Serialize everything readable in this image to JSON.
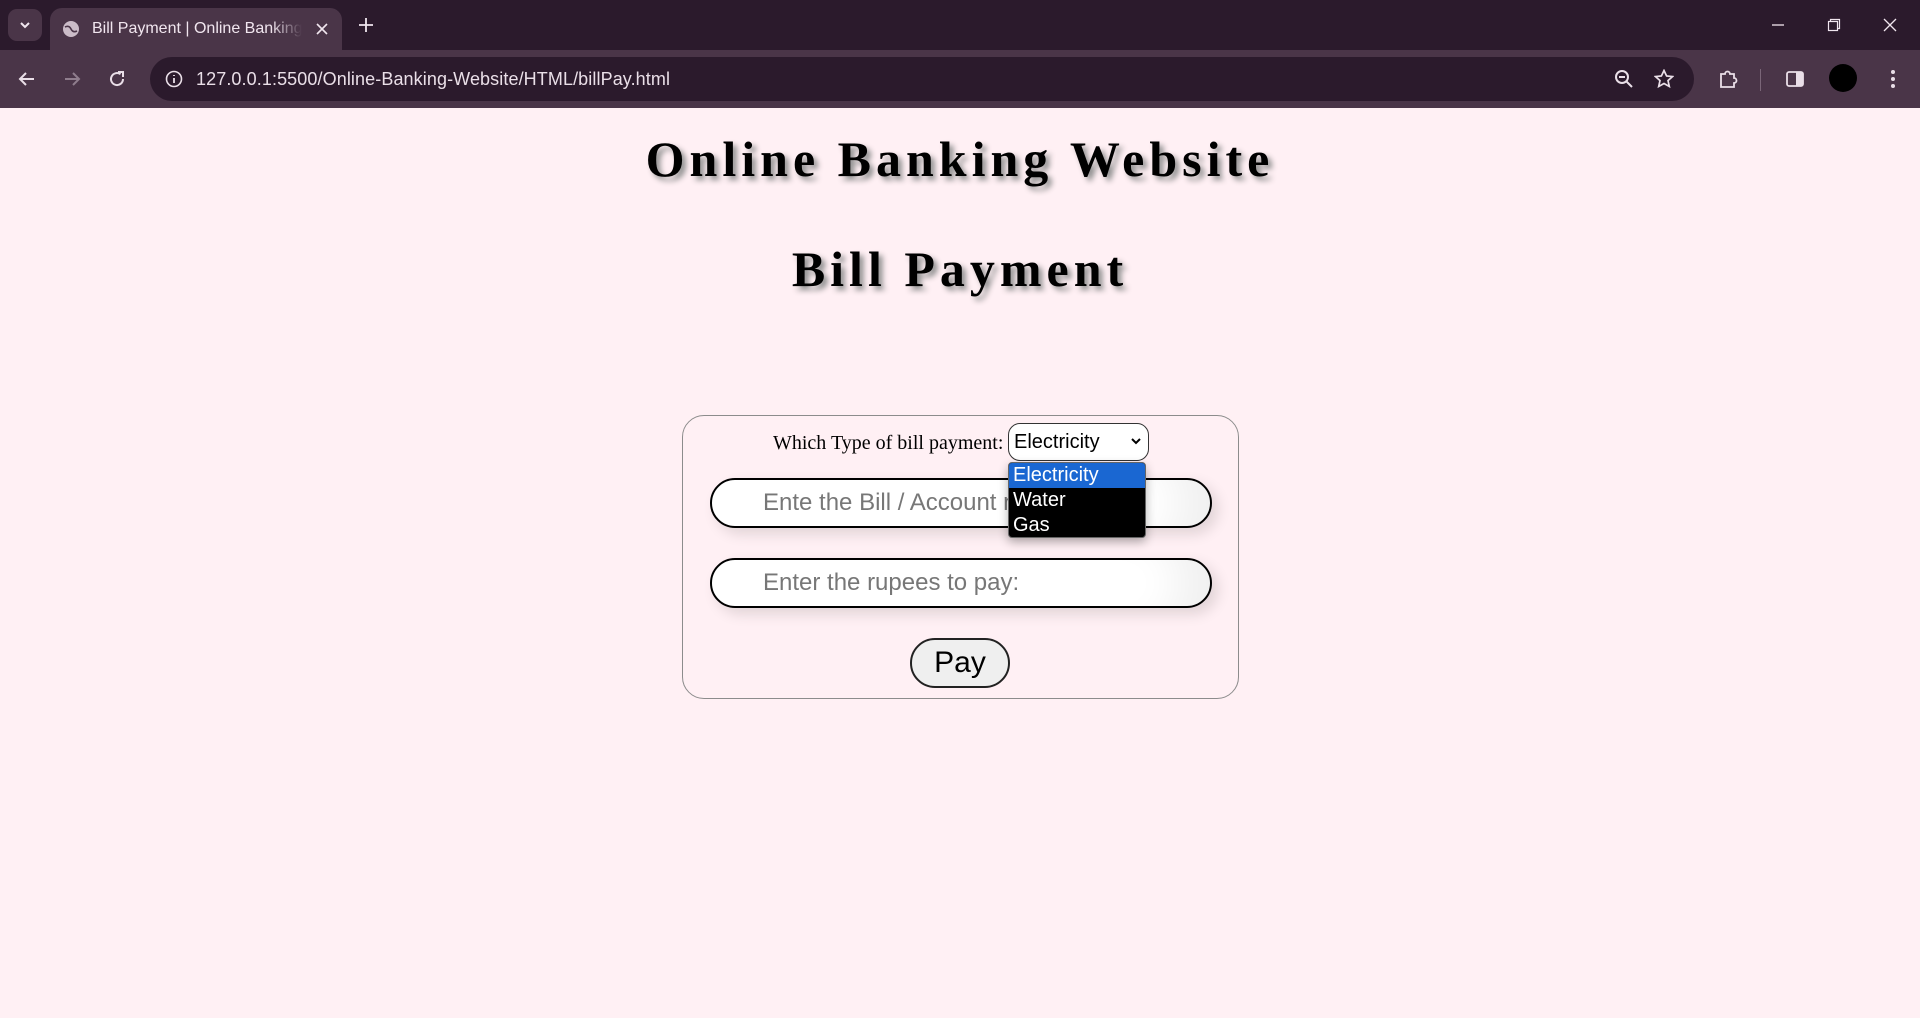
{
  "browser": {
    "tab_title": "Bill Payment | Online Banking Website",
    "url": "127.0.0.1:5500/Online-Banking-Website/HTML/billPay.html"
  },
  "page": {
    "site_title": "Online Banking Website",
    "page_title": "Bill Payment"
  },
  "form": {
    "type_label": "Which Type of bill payment:",
    "selected_type": "Electricity",
    "options": [
      "Electricity",
      "Water",
      "Gas"
    ],
    "bill_placeholder": "Ente the Bill / Account number:",
    "amount_placeholder": "Enter the rupees to pay:",
    "pay_label": "Pay"
  },
  "colors": {
    "page_bg": "#fff0f4",
    "selected_option": "#1a67d2",
    "chrome_dark": "#2b1a2c",
    "chrome_light": "#4a3548"
  }
}
